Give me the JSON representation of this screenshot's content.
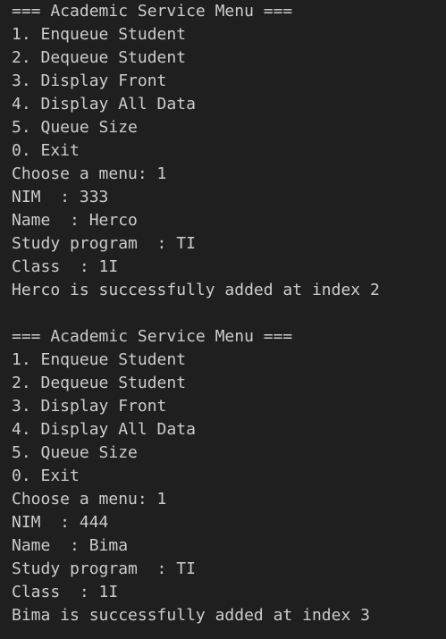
{
  "terminal": {
    "lines": [
      "=== Academic Service Menu ===",
      "1. Enqueue Student",
      "2. Dequeue Student",
      "3. Display Front",
      "4. Display All Data",
      "5. Queue Size",
      "0. Exit",
      "Choose a menu: 1",
      "NIM  : 333",
      "Name  : Herco",
      "Study program  : TI",
      "Class  : 1I",
      "Herco is successfully added at index 2",
      "",
      "=== Academic Service Menu ===",
      "1. Enqueue Student",
      "2. Dequeue Student",
      "3. Display Front",
      "4. Display All Data",
      "5. Queue Size",
      "0. Exit",
      "Choose a menu: 1",
      "NIM  : 444",
      "Name  : Bima",
      "Study program  : TI",
      "Class  : 1I",
      "Bima is successfully added at index 3"
    ]
  }
}
